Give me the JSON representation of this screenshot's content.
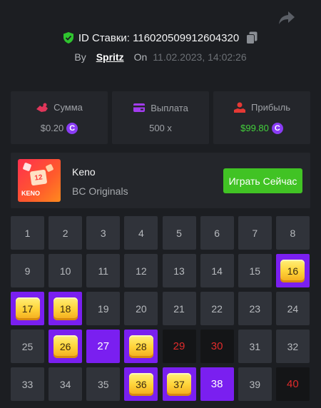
{
  "bet": {
    "id_label": "ID Ставки: 116020509912604320",
    "by_label": "By",
    "username": "Spritz",
    "on_label": "On",
    "date": "11.02.2023, 14:02:26"
  },
  "stats": [
    {
      "title": "Сумма",
      "value": "$0.20",
      "has_coin": true,
      "icon": "money-bag-icon",
      "icon_color": "#e0365a"
    },
    {
      "title": "Выплата",
      "value": "500 x",
      "has_coin": false,
      "icon": "wallet-icon",
      "icon_color": "#a33cf0"
    },
    {
      "title": "Прибыль",
      "value": "$99.80",
      "has_coin": true,
      "icon": "profit-icon",
      "icon_color": "#e53935",
      "value_color": "#43d13c"
    }
  ],
  "game": {
    "name": "Keno",
    "provider": "BC Originals",
    "thumb_text": "KENO",
    "thumb_number": "12",
    "play_label": "Играть Сейчас"
  },
  "coin_symbol": "C",
  "colors": {
    "accent": "#7a1ff0",
    "play": "#41c324",
    "miss": "#e02b2b",
    "win": "#43d13c"
  },
  "board": [
    {
      "n": "1",
      "s": "normal"
    },
    {
      "n": "2",
      "s": "normal"
    },
    {
      "n": "3",
      "s": "normal"
    },
    {
      "n": "4",
      "s": "normal"
    },
    {
      "n": "5",
      "s": "normal"
    },
    {
      "n": "6",
      "s": "normal"
    },
    {
      "n": "7",
      "s": "normal"
    },
    {
      "n": "8",
      "s": "normal"
    },
    {
      "n": "9",
      "s": "normal"
    },
    {
      "n": "10",
      "s": "normal"
    },
    {
      "n": "11",
      "s": "normal"
    },
    {
      "n": "12",
      "s": "normal"
    },
    {
      "n": "13",
      "s": "normal"
    },
    {
      "n": "14",
      "s": "normal"
    },
    {
      "n": "15",
      "s": "normal"
    },
    {
      "n": "16",
      "s": "hit"
    },
    {
      "n": "17",
      "s": "hit"
    },
    {
      "n": "18",
      "s": "hit"
    },
    {
      "n": "19",
      "s": "normal"
    },
    {
      "n": "20",
      "s": "normal"
    },
    {
      "n": "21",
      "s": "normal"
    },
    {
      "n": "22",
      "s": "normal"
    },
    {
      "n": "23",
      "s": "normal"
    },
    {
      "n": "24",
      "s": "normal"
    },
    {
      "n": "25",
      "s": "normal"
    },
    {
      "n": "26",
      "s": "hit"
    },
    {
      "n": "27",
      "s": "sel"
    },
    {
      "n": "28",
      "s": "hit"
    },
    {
      "n": "29",
      "s": "miss"
    },
    {
      "n": "30",
      "s": "miss"
    },
    {
      "n": "31",
      "s": "normal"
    },
    {
      "n": "32",
      "s": "normal"
    },
    {
      "n": "33",
      "s": "normal"
    },
    {
      "n": "34",
      "s": "normal"
    },
    {
      "n": "35",
      "s": "normal"
    },
    {
      "n": "36",
      "s": "hit"
    },
    {
      "n": "37",
      "s": "hit"
    },
    {
      "n": "38",
      "s": "sel"
    },
    {
      "n": "39",
      "s": "normal"
    },
    {
      "n": "40",
      "s": "miss"
    }
  ]
}
